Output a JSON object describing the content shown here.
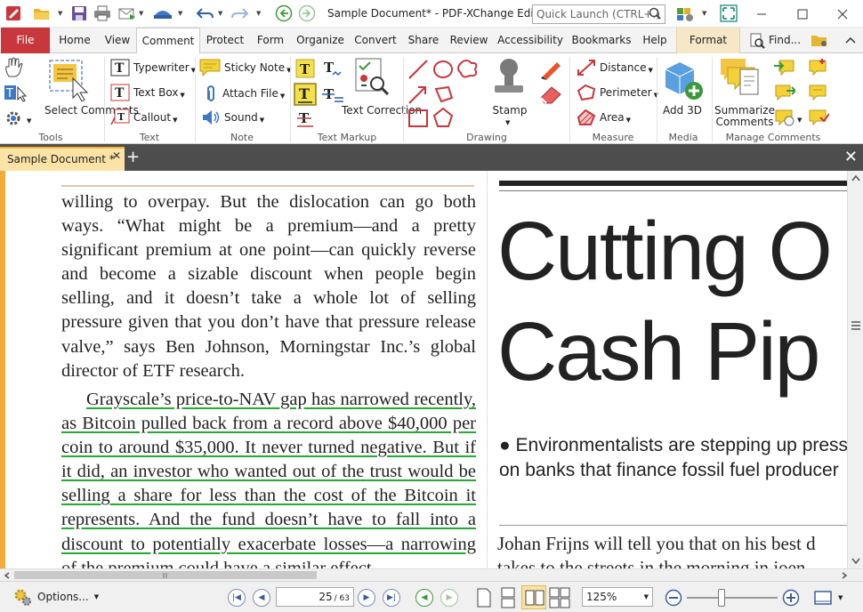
{
  "titlebar": {
    "title": "Sample Document* - PDF-XChange Editor",
    "quick_launch_placeholder": "Quick Launch (CTRL+.)",
    "find_label": "Find..."
  },
  "menu": {
    "tabs": [
      "File",
      "Home",
      "View",
      "Comment",
      "Protect",
      "Form",
      "Organize",
      "Convert",
      "Share",
      "Review",
      "Accessibility",
      "Bookmarks",
      "Help",
      "Format"
    ],
    "active": "Comment"
  },
  "ribbon": {
    "groups": [
      "Tools",
      "Text",
      "Note",
      "Text Markup",
      "Drawing",
      "Measure",
      "Media",
      "Manage Comments"
    ],
    "select_comments": "Select Comments",
    "typewriter": "Typewriter",
    "text_box": "Text Box",
    "callout": "Callout",
    "sticky_note": "Sticky Note",
    "attach_file": "Attach File",
    "sound": "Sound",
    "text_correction": "Text Correction",
    "stamp": "Stamp",
    "distance": "Distance",
    "perimeter": "Perimeter",
    "area": "Area",
    "add_3d": "Add 3D",
    "summarize_comments": "Summarize Comments"
  },
  "doc_tab": {
    "label": "Sample Document *"
  },
  "document": {
    "para1": "willing to overpay. But the dislocation can go both ways. “What might be a premium—and a pretty significant premium at one point—can quickly reverse and become a sizable discount when people begin selling, and it doesn’t take a whole lot of selling pressure given that you don’t have that pressure release valve,” says Ben Johnson, Morningstar Inc.’s global director of ETF research.",
    "para2": "Grayscale’s price-to-NAV gap has narrowed recently, as Bitcoin pulled back from a record above $40,000 per coin to around $35,000. It never turned negative. But if it did, an investor who wanted out of the trust would be selling a share for less than the cost of the Bitcoin it represents. And the fund doesn’t have to fall into a discount to potentially exacerbate losses—a narrowing of the premium could have a similar effect.",
    "headline_line1": "Cutting O",
    "headline_line2": "Cash Pip",
    "bullet_line1": "● Environmentalists are stepping up press",
    "bullet_line2": "on banks that finance fossil fuel producer",
    "byline_line1": "Johan Frijns will tell you that on his best d",
    "byline_line2": "takes to the streets in the morning in joen"
  },
  "status": {
    "options_label": "Options...",
    "current_page": "25",
    "total_pages": "/ 63",
    "zoom": "125%",
    "zoom_level": 0.38
  },
  "colors": {
    "file_tab": "#c8373c",
    "doc_border": "#f3ab3a",
    "underline": "#22aa33",
    "format_tab": "#f6e7c6"
  }
}
